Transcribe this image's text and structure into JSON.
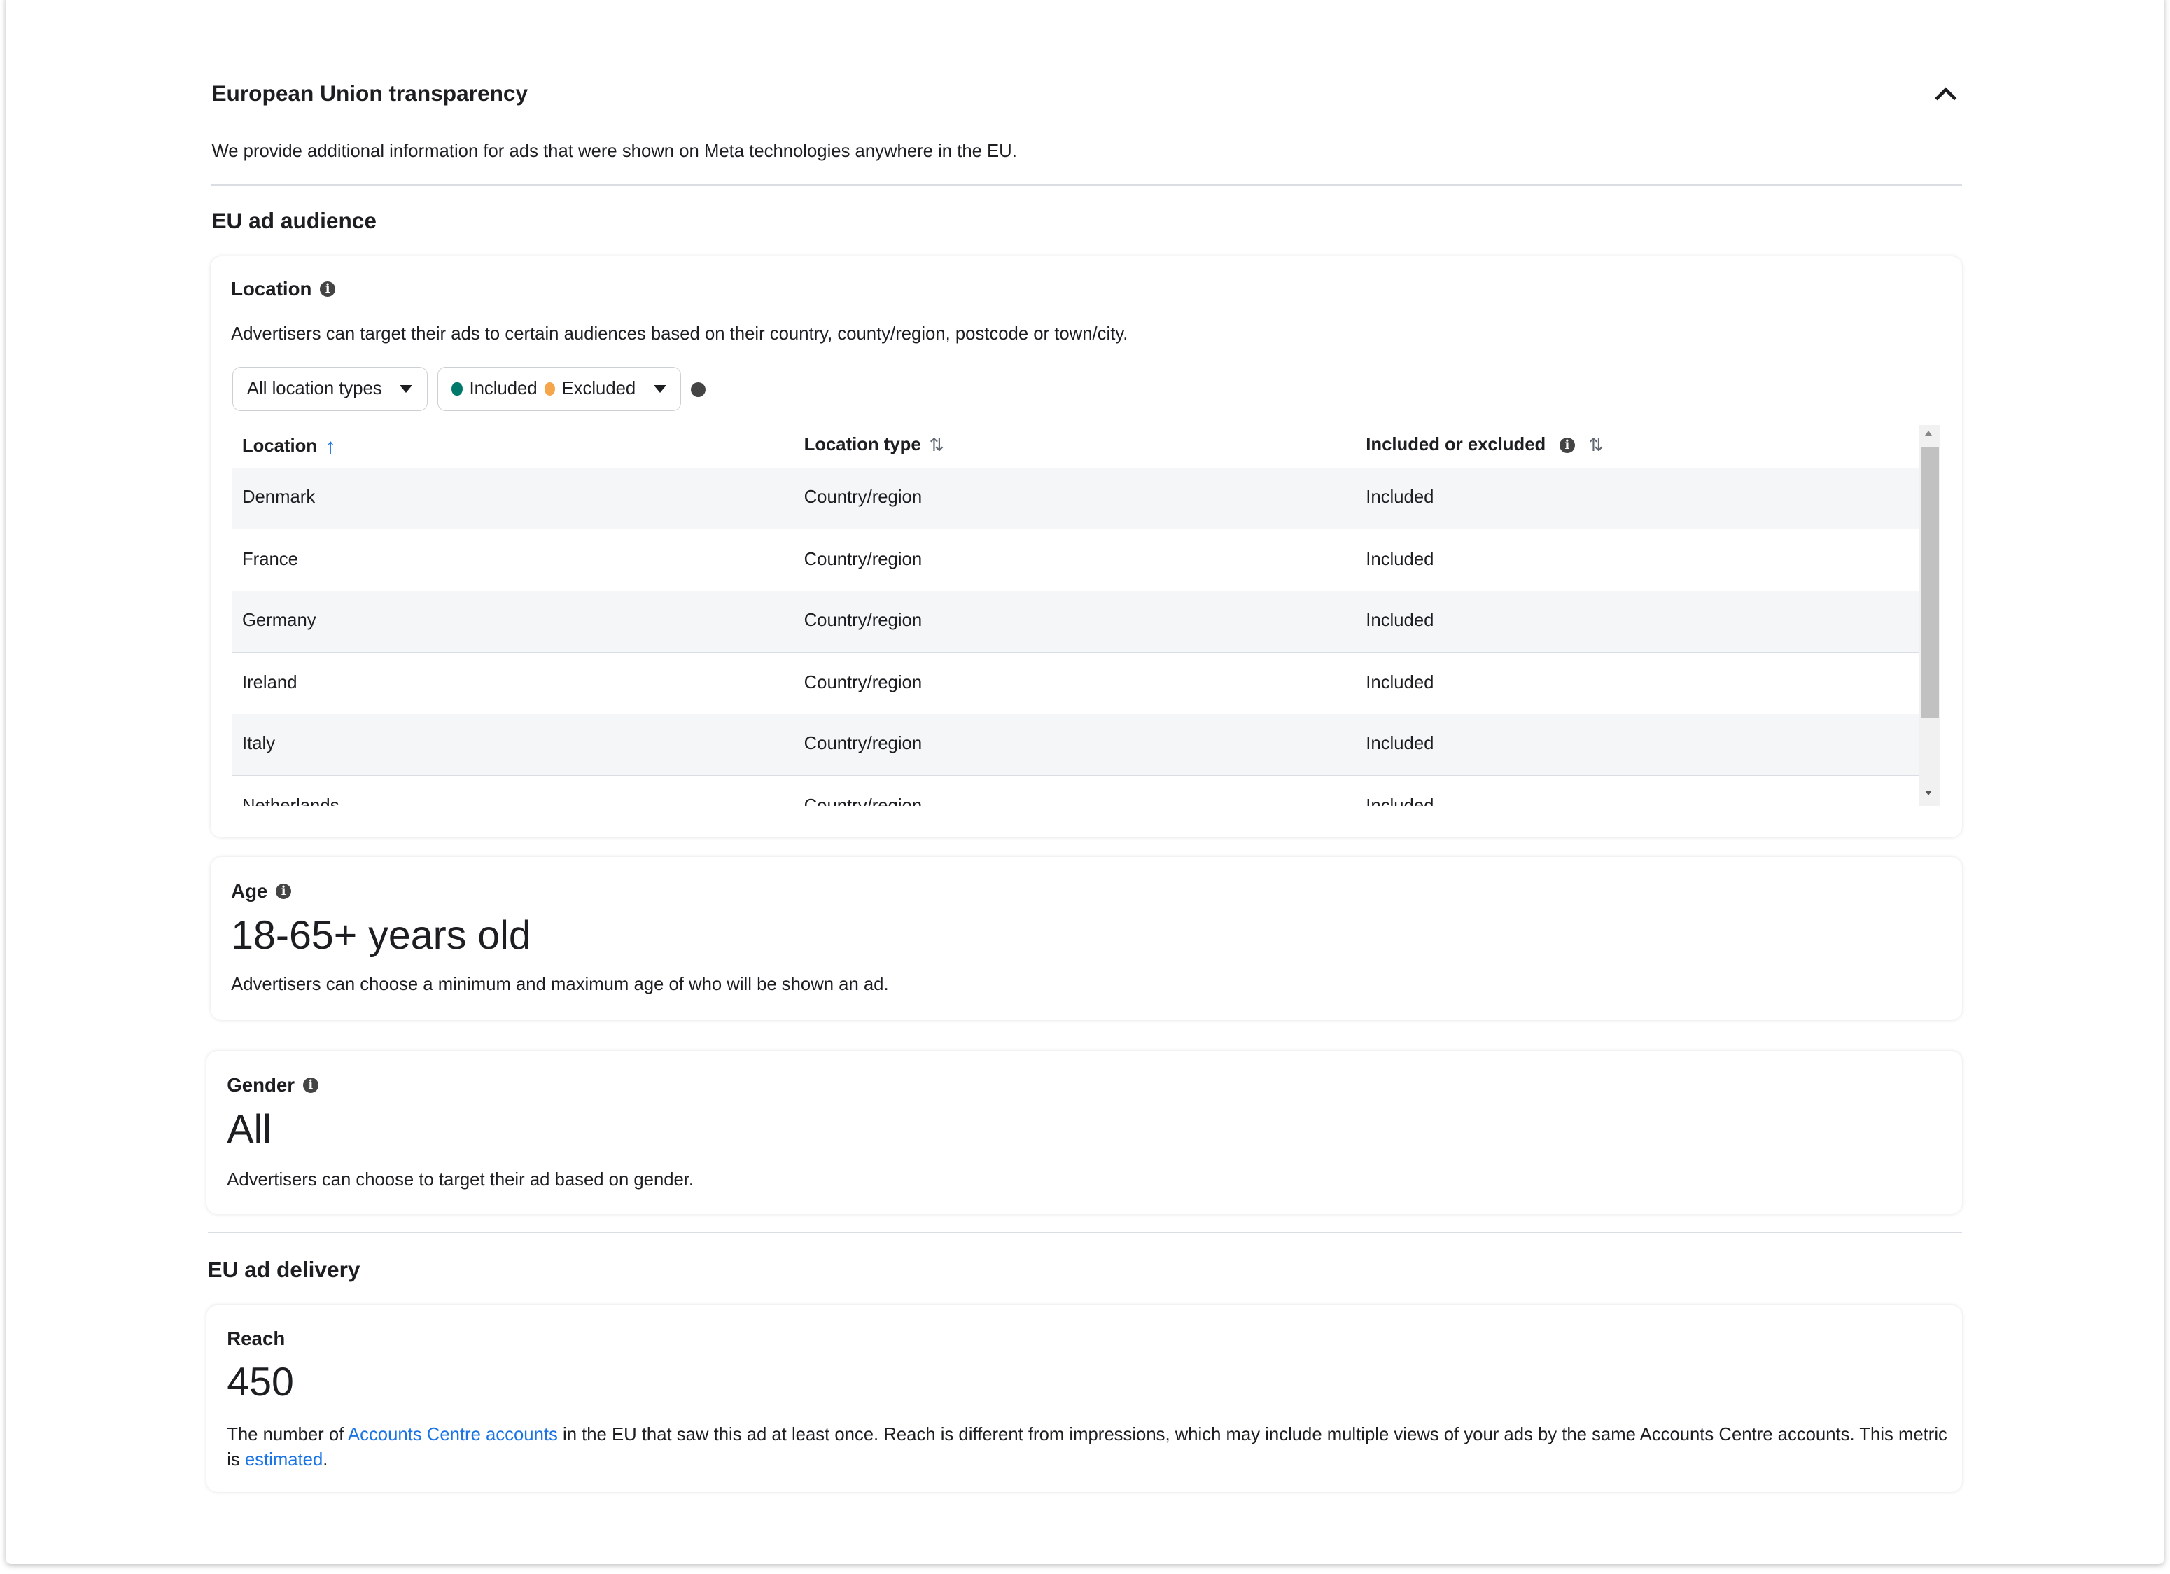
{
  "section": {
    "title": "European Union transparency",
    "description": "We provide additional information for ads that were shown on Meta technologies anywhere in the EU."
  },
  "audience": {
    "title": "EU ad audience",
    "location": {
      "label": "Location",
      "description": "Advertisers can target their ads to certain audiences based on their country, county/region, postcode or town/city.",
      "filter_type": "All location types",
      "filter_included": "Included",
      "filter_excluded": "Excluded",
      "columns": [
        "Location",
        "Location type",
        "Included or excluded"
      ],
      "rows": [
        [
          "Denmark",
          "Country/region",
          "Included"
        ],
        [
          "France",
          "Country/region",
          "Included"
        ],
        [
          "Germany",
          "Country/region",
          "Included"
        ],
        [
          "Ireland",
          "Country/region",
          "Included"
        ],
        [
          "Italy",
          "Country/region",
          "Included"
        ],
        [
          "Netherlands",
          "Country/region",
          "Included"
        ]
      ]
    },
    "age": {
      "label": "Age",
      "value": "18-65+ years old",
      "description": "Advertisers can choose a minimum and maximum age of who will be shown an ad."
    },
    "gender": {
      "label": "Gender",
      "value": "All",
      "description": "Advertisers can choose to target their ad based on gender."
    }
  },
  "delivery": {
    "title": "EU ad delivery",
    "reach": {
      "label": "Reach",
      "value": "450",
      "desc_1": "The number of ",
      "link_1": "Accounts Centre accounts",
      "desc_2": " in the EU that saw this ad at least once. Reach is different from impressions, which may include multiple views of your ads by the same Accounts Centre accounts. This metric is ",
      "link_2": "estimated",
      "desc_3": "."
    }
  },
  "colors": {
    "link": "#1b74e4",
    "included": "#00796b",
    "excluded": "#f5a54a"
  }
}
